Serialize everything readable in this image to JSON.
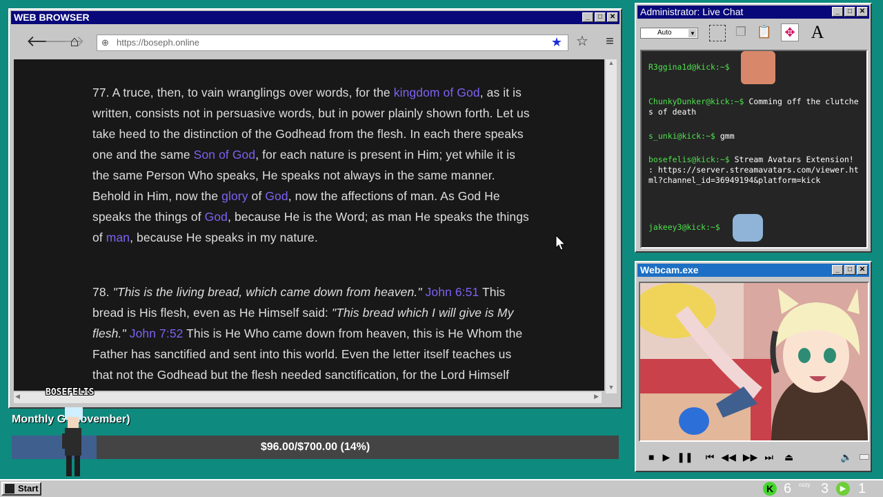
{
  "browser": {
    "title": "WEB BROWSER",
    "url": "https://boseph.online",
    "paragraphs": {
      "p77": {
        "s1": "77. A truce, then, to vain wranglings over words, for the ",
        "l1": "kingdom of God",
        "s2": ", as it is written, consists not in persuasive words, but in power plainly shown forth. Let us take heed to the distinction of the Godhead from the flesh. In each there speaks one and the same ",
        "l2": "Son of God",
        "s3": ", for each nature is present in Him; yet while it is the same Person Who speaks, He speaks not always in the same manner. Behold in Him, now the ",
        "l3": "glory",
        "s4": " of ",
        "l4": "God",
        "s5": ", now the affections of man. As God He speaks the things of ",
        "l5": "God",
        "s6": ", because He is the Word; as man He speaks the things of ",
        "l6": "man",
        "s7": ", because He speaks in my nature."
      },
      "p78": {
        "s1": "78. ",
        "q1": "\"This is the living bread, which came down from heaven.\"",
        "l1": "John 6:51",
        "s2": " This bread is His flesh, even as He Himself said: ",
        "q2": "\"This bread which I will give is My flesh.\"",
        "l2": "John 7:52",
        "s3": " This is He Who came down from heaven, this is He Whom the Father has sanctified and sent into this world. Even the letter itself teaches us that not the Godhead but the flesh needed sanctification, for the Lord Himself"
      }
    }
  },
  "chat": {
    "title": "Administrator: Live Chat",
    "dropdown": "Auto",
    "messages": [
      {
        "user": "R3ggina1d@kick:~$",
        "text": ""
      },
      {
        "user": "ChunkyDunker@kick:~$",
        "text": " Comming off the clutches of death"
      },
      {
        "user": "s_unki@kick:~$",
        "text": " gmm"
      },
      {
        "user": "bosefelis@kick:~$",
        "text": " Stream Avatars Extension! : https://server.streamavatars.com/viewer.html?channel_id=36949194&platform=kick"
      },
      {
        "user": "jakeey3@kick:~$",
        "text": ""
      }
    ]
  },
  "webcam": {
    "title": "Webcam.exe"
  },
  "goal": {
    "label": "Monthly G    (November)",
    "amount": "$96.00/$700.00 (14%)",
    "percent": 14
  },
  "avatar_name": "BOSEFELIS",
  "taskbar": {
    "start": "Start",
    "count_a": "6",
    "count_b": "3",
    "count_c": "1",
    "cozy": "cozy"
  },
  "colors": {
    "title_bar": "#08087a",
    "link": "#7d62f0",
    "chat_user": "#4ee24e",
    "desktop": "#0f8a7e"
  },
  "icons": [
    "back-arrow-icon",
    "forward-arrow-icon",
    "home-icon",
    "globe-icon",
    "star-filled-icon",
    "star-outline-icon",
    "menu-icon",
    "minimize-icon",
    "maximize-icon",
    "close-icon",
    "stop-icon",
    "play-icon",
    "pause-icon",
    "skip-back-icon",
    "rewind-icon",
    "fast-forward-icon",
    "skip-forward-icon",
    "eject-icon",
    "volume-icon",
    "kick-icon",
    "play-circle-icon"
  ]
}
